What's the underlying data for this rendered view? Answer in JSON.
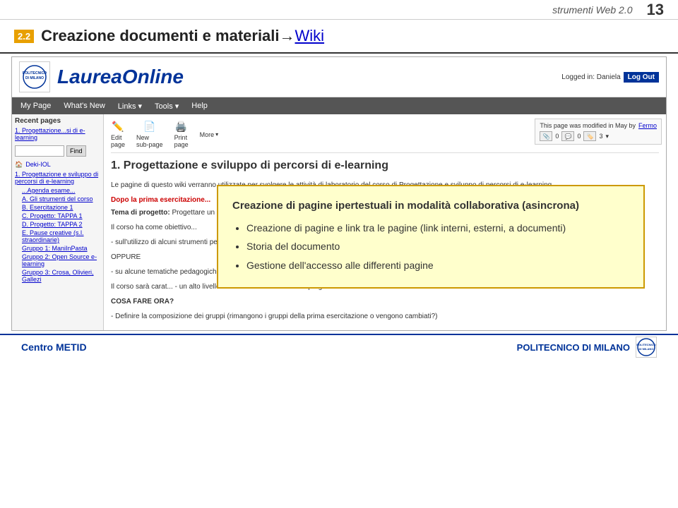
{
  "header": {
    "subtitle": "strumenti Web 2.0",
    "slide_number": "13"
  },
  "title": {
    "badge": "2.2",
    "text": "Creazione documenti e materiali→ ",
    "link": "Wiki"
  },
  "wiki": {
    "logo": {
      "institution": "POLITECNICO\nDI MILANO"
    },
    "site_title": "LaureaOnline",
    "login_text": "Logged in: Daniela",
    "logout_label": "Log Out",
    "nav": {
      "items": [
        "My Page",
        "What's New",
        "Links ▾",
        "Tools ▾",
        "Help"
      ]
    },
    "sidebar": {
      "recent_pages_label": "Recent pages",
      "page_link": "1. Progettazione...si di e-learning",
      "find_placeholder": "",
      "find_btn": "Find",
      "nav_items": [
        {
          "label": "Deki-IOL",
          "icon": "🏠"
        },
        {
          "label": "1. Progettazione e sviluppo di percorsi di e-learning",
          "sub": false
        },
        {
          "label": "...Agenda esame...",
          "sub": true
        },
        {
          "label": "A. Gli strumenti del corso",
          "sub": true
        },
        {
          "label": "B. Esercitazione 1",
          "sub": true
        },
        {
          "label": "C. Progetto: TAPPA 1",
          "sub": true
        },
        {
          "label": "D. Progetto: TAPPA 2",
          "sub": true
        },
        {
          "label": "E. Pause creative (s.l. straordinarie)",
          "sub": true
        },
        {
          "label": "Gruppo 1: ManiInPasta",
          "sub": true
        },
        {
          "label": "Gruppo 2: Open Source e-learning",
          "sub": true
        },
        {
          "label": "Gruppo 3: Crosa, Olivieri, Gallezi",
          "sub": true
        }
      ]
    },
    "toolbar": {
      "edit_label": "Edit\npage",
      "new_label": "New\nsub-page",
      "print_label": "Print\npage",
      "more_label": "More"
    },
    "info_box": {
      "modified_text": "This page was modified in May by",
      "modified_by": "Fermo",
      "count1": "0",
      "count2": "0",
      "count3": "3"
    },
    "article": {
      "title": "1. Progettazione e sviluppo di percorsi di e-learning",
      "intro": "Le pagine di questo wiki verranno utilizzate per svolgere le attività di laboratorio del corso di Progettazione e sviluppo di percorsi di e-learning",
      "section_title": "Dopo la prima esercitazione...",
      "tema_label": "Tema di progetto:",
      "tema_text": "Progettare un breve corso e-learning su di un tema di lavoro.",
      "corso_label": "Il corso ha come obiettivo...",
      "item1": "- sull'utilizzo di alcuni strumenti per lo svolgimento delle esercitazione han...",
      "oppure": "OPPURE",
      "item2": "- su alcune tematiche pedagogiche/metodologiche legate all'e- (per gruppi che ha... learning, ovvero m...",
      "item3": "Il corso sarà carat... - un alto livello di i... - l'utilizzo di strum... Il progetto verrà s...",
      "cosa_label": "COSA FARE ORA?",
      "cosa_text": "- Definire la composizione dei gruppi (rimangono i gruppi della prima esercitazione o vengono cambiati?)"
    }
  },
  "tooltip": {
    "header": "Creazione di pagine ipertestuali in modalità collaborativa (asincrona)",
    "items": [
      "Creazione di pagine e link tra le pagine (link interni, esterni, a documenti)",
      "Storia del documento",
      "Gestione dell'accesso alle differenti pagine"
    ]
  },
  "footer": {
    "left": "Centro METID",
    "right": "POLITECNICO DI MILANO"
  }
}
